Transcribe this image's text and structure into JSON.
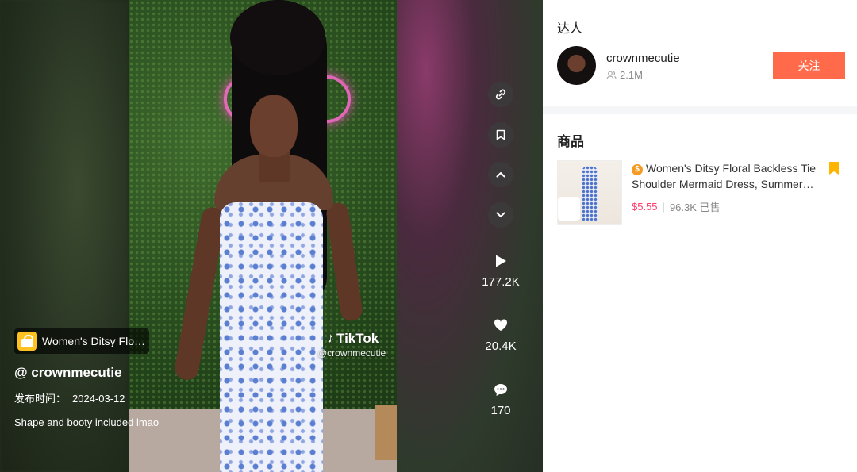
{
  "video": {
    "product_tag": "Women's Ditsy Floral Backless Tie Shoulder Mermaid Dress",
    "author_handle": "@ crownmecutie",
    "publish_label": "发布时间：",
    "publish_date": "2024-03-12",
    "caption": "Shape and booty included lmao",
    "watermark_brand": "TikTok",
    "watermark_handle": "@crownmecutie",
    "plays": "177.2K",
    "likes": "20.4K",
    "comments": "170",
    "icons": [
      "link-icon",
      "bookmark-icon",
      "chevron-up-icon",
      "chevron-down-icon",
      "play-icon",
      "heart-icon",
      "comment-icon"
    ]
  },
  "panel": {
    "creator_section_title": "达人",
    "creator_name": "crownmecutie",
    "followers": "2.1M",
    "follow_label": "关注",
    "products_section_title": "商品",
    "product": {
      "title": "Women's Ditsy Floral Backless Tie Shoulder Mermaid Dress, Summer Clothes",
      "price": "$5.55",
      "sold": "96.3K 已售"
    }
  },
  "colors": {
    "follow_button": "#ff6b4a",
    "price": "#ff3b6b",
    "bookmark_flag": "#ffb400",
    "product_tag_icon": "#ffc120"
  }
}
